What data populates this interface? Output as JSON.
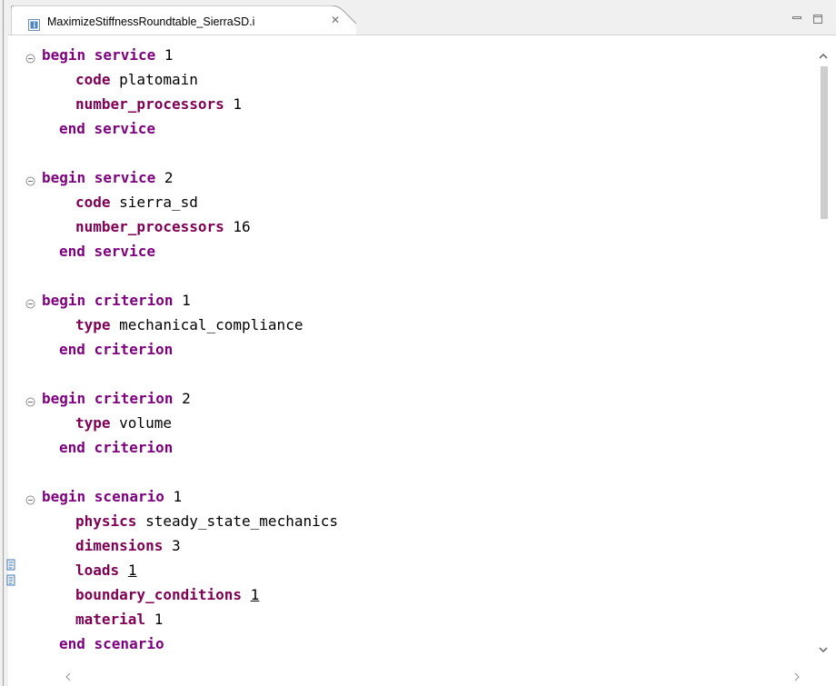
{
  "editor_tab": {
    "title": "MaximizeStiffnessRoundtable_SierraSD.i",
    "close_glyph": "✕"
  },
  "code": {
    "blocks": [
      {
        "begin_kw": "begin service",
        "begin_arg": " 1",
        "body": [
          {
            "kw": "code",
            "val": " platomain"
          },
          {
            "kw": "number_processors",
            "val": " 1"
          }
        ],
        "end_kw": "end service"
      },
      {
        "begin_kw": "begin service",
        "begin_arg": " 2",
        "body": [
          {
            "kw": "code",
            "val": " sierra_sd"
          },
          {
            "kw": "number_processors",
            "val": " 16"
          }
        ],
        "end_kw": "end service"
      },
      {
        "begin_kw": "begin criterion",
        "begin_arg": " 1",
        "body": [
          {
            "kw": "type",
            "val": " mechanical_compliance"
          }
        ],
        "end_kw": "end criterion"
      },
      {
        "begin_kw": "begin criterion",
        "begin_arg": " 2",
        "body": [
          {
            "kw": "type",
            "val": " volume"
          }
        ],
        "end_kw": "end criterion"
      },
      {
        "begin_kw": "begin scenario",
        "begin_arg": " 1",
        "body": [
          {
            "kw": "physics",
            "val": " steady_state_mechanics"
          },
          {
            "kw": "dimensions",
            "val": " 3"
          },
          {
            "kw": "loads",
            "val_prefix": " ",
            "val_link": "1"
          },
          {
            "kw": "boundary_conditions",
            "val_prefix": " ",
            "val_link": "1"
          },
          {
            "kw": "material",
            "val": " 1"
          }
        ],
        "end_kw": "end scenario"
      }
    ]
  },
  "colors": {
    "keyword_block": "#7f007f",
    "keyword_param": "#7f0055",
    "text": "#000000",
    "scroll_thumb": "#cdcdcd"
  },
  "icons": {
    "tab_file": "info-file-icon",
    "fold": "fold-collapse-icon",
    "minimize": "minimize-icon",
    "maximize": "maximize-icon",
    "overview_marker": "overview-marker-icon"
  }
}
